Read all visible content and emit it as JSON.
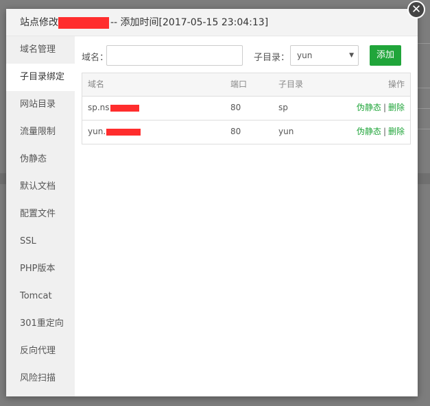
{
  "dialog": {
    "title_prefix": "站点修改",
    "title_suffix": "-- 添加时间[2017-05-15 23:04:13]",
    "close_symbol": "✕"
  },
  "sidebar": {
    "items": [
      {
        "label": "域名管理"
      },
      {
        "label": "子目录绑定",
        "active": true
      },
      {
        "label": "网站目录"
      },
      {
        "label": "流量限制"
      },
      {
        "label": "伪静态"
      },
      {
        "label": "默认文档"
      },
      {
        "label": "配置文件"
      },
      {
        "label": "SSL"
      },
      {
        "label": "PHP版本"
      },
      {
        "label": "Tomcat"
      },
      {
        "label": "301重定向"
      },
      {
        "label": "反向代理"
      },
      {
        "label": "风险扫描"
      }
    ]
  },
  "form": {
    "domain_label": "域名：",
    "domain_value": "",
    "subdir_label": "子目录：",
    "subdir_value": "yun",
    "add_button": "添加"
  },
  "table": {
    "columns": [
      "域名",
      "端口",
      "子目录",
      "操作"
    ],
    "rows": [
      {
        "domain_visible": "sp.ns",
        "port": "80",
        "subdir": "sp",
        "action_rewrite": "伪静态",
        "action_sep": "|",
        "action_delete": "删除"
      },
      {
        "domain_visible": "yun.",
        "port": "80",
        "subdir": "yun",
        "action_rewrite": "伪静态",
        "action_sep": "|",
        "action_delete": "删除"
      }
    ]
  },
  "colors": {
    "accent_green": "#20a53a",
    "redaction_red": "#ff2d2d"
  }
}
